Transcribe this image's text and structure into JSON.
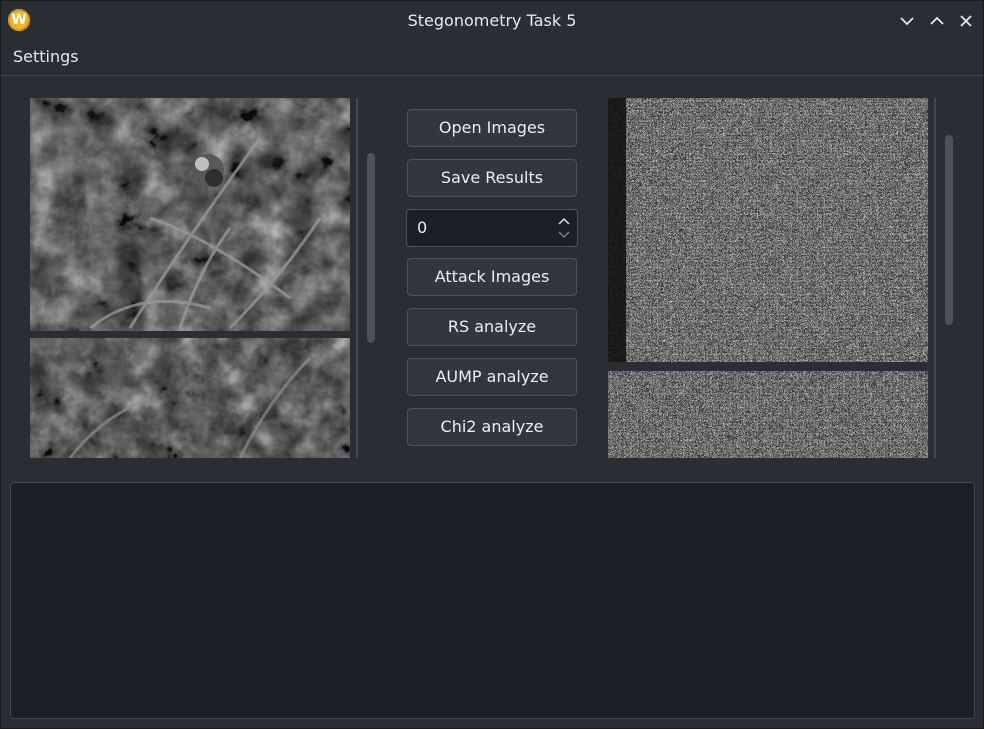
{
  "window": {
    "title": "Stegonometry Task 5",
    "app_icon_letter": "W"
  },
  "menubar": {
    "settings": "Settings"
  },
  "controls": {
    "open_images": "Open Images",
    "save_results": "Save Results",
    "spin_value": "0",
    "attack_images": "Attack Images",
    "rs_analyze": "RS analyze",
    "aump_analyze": "AUMP analyze",
    "chi2_analyze": "Chi2 analyze"
  },
  "colors": {
    "window_bg": "#2a2e32",
    "field_bg": "#1d2023",
    "icon_accent": "#f3b51d"
  },
  "icons": [
    "app-logo-icon",
    "minimize-icon",
    "maximize-icon",
    "close-icon",
    "spin-up-icon",
    "spin-down-icon"
  ]
}
